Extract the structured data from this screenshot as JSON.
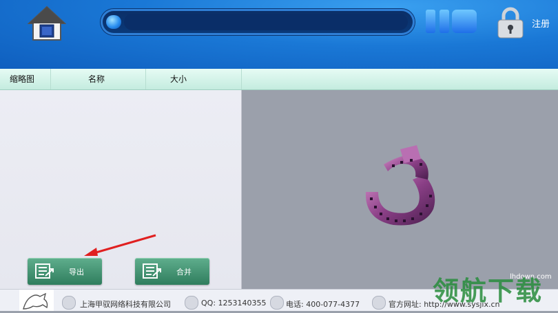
{
  "header": {
    "register_label": "注册"
  },
  "columns": [
    "缩略图",
    "名称",
    "大小"
  ],
  "buttons": {
    "export_label": "导出",
    "merge_label": "合并"
  },
  "footer": {
    "company": "上海甲驭网络科技有限公司",
    "qq": "QQ: 1253140355",
    "phone": "电话: 400-077-4377",
    "website": "官方网址: http://www.sysjix.cn"
  },
  "watermark": {
    "url": "lhdown.com",
    "brand": "领航下载"
  },
  "icons": {
    "home": "home-icon",
    "pause": "pause-icon",
    "stop": "stop-icon",
    "lock": "lock-icon",
    "film": "film-reel-icon"
  },
  "colors": {
    "header_blue": "#1a78d6",
    "button_green": "#3f8f6c",
    "column_bar": "#d4f3e8"
  }
}
